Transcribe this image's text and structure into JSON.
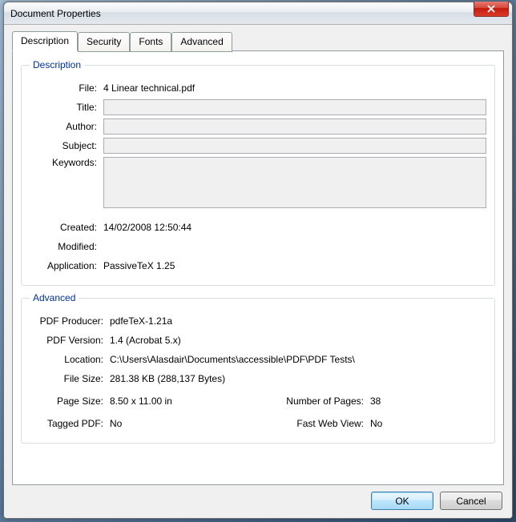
{
  "window": {
    "title": "Document Properties"
  },
  "tabs": {
    "t0": "Description",
    "t1": "Security",
    "t2": "Fonts",
    "t3": "Advanced"
  },
  "desc_group": {
    "legend": "Description",
    "file_label": "File:",
    "file_value": "4 Linear technical.pdf",
    "title_label": "Title:",
    "title_value": "",
    "author_label": "Author:",
    "author_value": "",
    "subject_label": "Subject:",
    "subject_value": "",
    "keywords_label": "Keywords:",
    "keywords_value": "",
    "created_label": "Created:",
    "created_value": "14/02/2008 12:50:44",
    "modified_label": "Modified:",
    "modified_value": "",
    "application_label": "Application:",
    "application_value": "PassiveTeX 1.25"
  },
  "adv_group": {
    "legend": "Advanced",
    "producer_label": "PDF Producer:",
    "producer_value": "pdfeTeX-1.21a",
    "version_label": "PDF Version:",
    "version_value": "1.4 (Acrobat 5.x)",
    "location_label": "Location:",
    "location_value": "C:\\Users\\Alasdair\\Documents\\accessible\\PDF\\PDF Tests\\",
    "filesize_label": "File Size:",
    "filesize_value": "281.38 KB (288,137 Bytes)",
    "pagesize_label": "Page Size:",
    "pagesize_value": "8.50 x 11.00 in",
    "numpages_label": "Number of Pages:",
    "numpages_value": "38",
    "tagged_label": "Tagged PDF:",
    "tagged_value": "No",
    "fastweb_label": "Fast Web View:",
    "fastweb_value": "No"
  },
  "buttons": {
    "ok": "OK",
    "cancel": "Cancel"
  }
}
